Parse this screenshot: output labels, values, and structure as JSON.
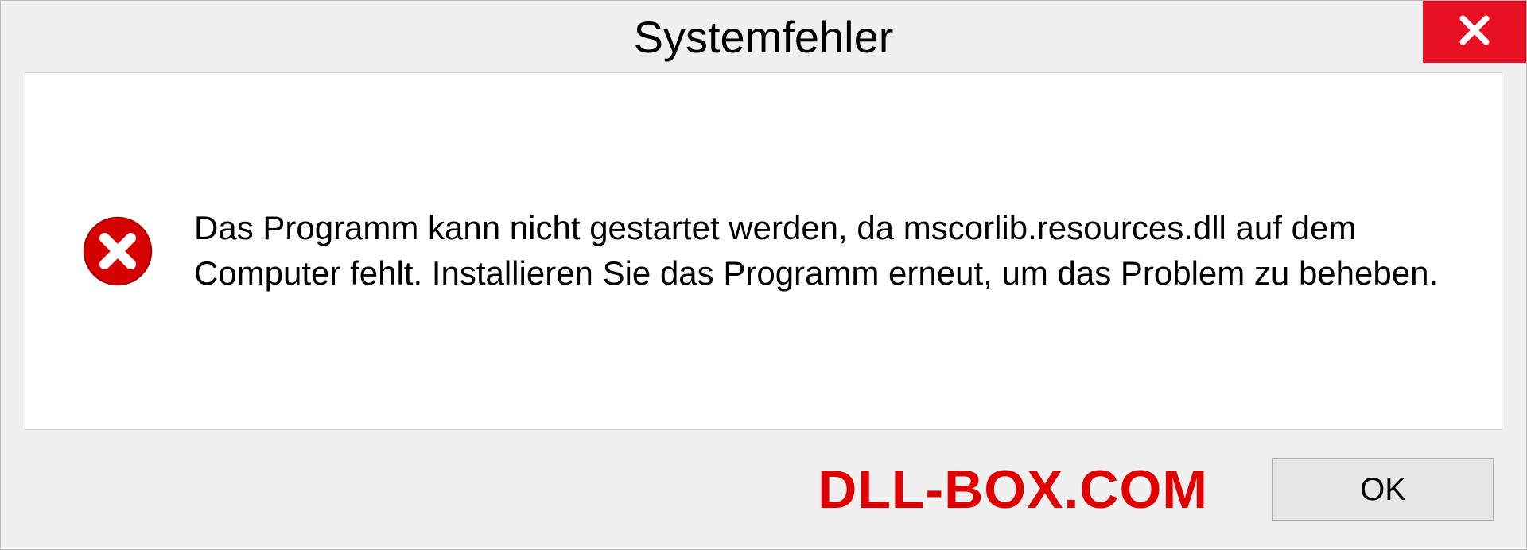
{
  "dialog": {
    "title": "Systemfehler",
    "message": "Das Programm kann nicht gestartet werden, da mscorlib.resources.dll auf dem Computer fehlt. Installieren Sie das Programm erneut, um das Problem zu beheben.",
    "ok_label": "OK"
  },
  "watermark": "DLL-BOX.COM",
  "colors": {
    "close_bg": "#e81123",
    "error_icon": "#d60000",
    "watermark": "#e00000"
  }
}
